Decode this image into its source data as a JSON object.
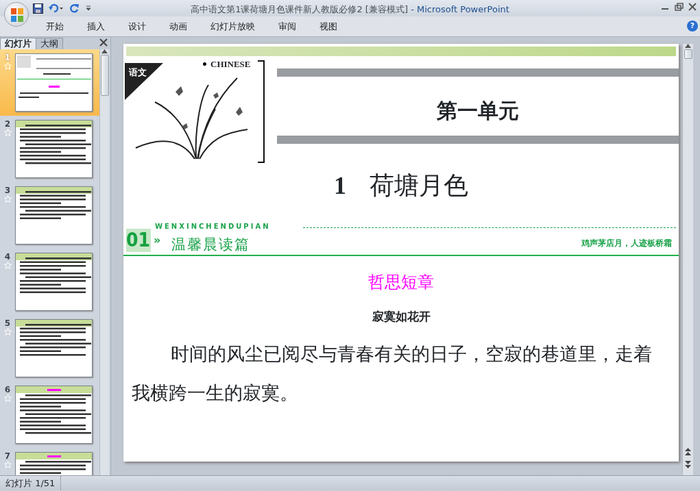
{
  "window": {
    "title": "高中语文第1课荷塘月色课件新人教版必修2 [兼容模式]",
    "separator": "-",
    "app": "Microsoft PowerPoint",
    "help": "?"
  },
  "ribbon_tabs": [
    {
      "label": "开始",
      "selected": false
    },
    {
      "label": "插入",
      "selected": false
    },
    {
      "label": "设计",
      "selected": false
    },
    {
      "label": "动画",
      "selected": false
    },
    {
      "label": "幻灯片放映",
      "selected": false
    },
    {
      "label": "审阅",
      "selected": false
    },
    {
      "label": "视图",
      "selected": false
    }
  ],
  "pane_tabs": [
    {
      "label": "幻灯片",
      "selected": true
    },
    {
      "label": "大纲",
      "selected": false
    }
  ],
  "thumbnails": [
    {
      "number": "1",
      "selected": true,
      "kind": "title"
    },
    {
      "number": "2",
      "selected": false,
      "kind": "text"
    },
    {
      "number": "3",
      "selected": false,
      "kind": "text"
    },
    {
      "number": "4",
      "selected": false,
      "kind": "text"
    },
    {
      "number": "5",
      "selected": false,
      "kind": "text"
    },
    {
      "number": "6",
      "selected": false,
      "kind": "heading"
    },
    {
      "number": "7",
      "selected": false,
      "kind": "heading"
    }
  ],
  "slide": {
    "subject_tag": "语文",
    "subject_en": "CHINESE",
    "unit": "第一单元",
    "lesson_number": "1",
    "lesson_title": "荷塘月色",
    "section": {
      "number": "01",
      "pinyin": "WENXINCHENDUPIAN",
      "marker": "»",
      "title": "温馨晨读篇",
      "quote": "鸡声茅店月，人迹板桥霜"
    },
    "category": "哲思短章",
    "essay_title": "寂寞如花开",
    "paragraph": "时间的风尘已阅尽与青春有关的日子，空寂的巷道里，走着我横跨一生的寂寞。"
  },
  "status_bar": {
    "text": "幻灯片 1/51"
  }
}
